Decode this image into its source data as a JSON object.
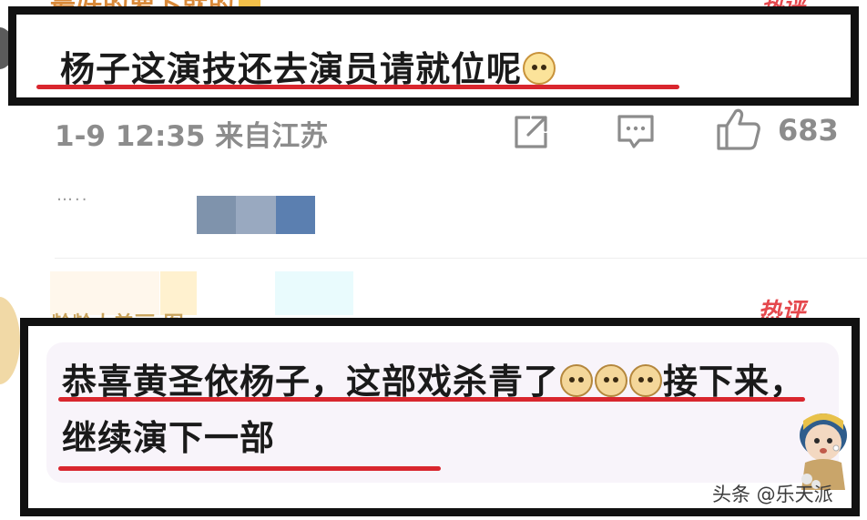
{
  "top_cutoff": {
    "text": "最好的萝卜就的",
    "hot_badge": "热评"
  },
  "comment_1": {
    "text": "杨子这演技还去演员请就位呢",
    "emoji": "shushing-face-emoji"
  },
  "meta": {
    "time_location": "1-9 12:35 来自江苏",
    "share_icon": "share-icon",
    "comment_icon": "comment-icon",
    "like_icon": "like-icon",
    "like_count": "683"
  },
  "blurred": {
    "ellipsis": "…..",
    "mosaic_colors": [
      "#7f93ac",
      "#99a9c0",
      "#5b7fb0"
    ]
  },
  "mid_cutoff": {
    "text": "龄龄大美丽 图",
    "hot_badge": "热评"
  },
  "comment_2": {
    "part_1": "恭喜黄圣依杨子，这部戏杀青了",
    "emojis": [
      "doge-emoji",
      "doge-emoji",
      "doge-emoji"
    ],
    "part_2": "接下来，继续演下一部"
  },
  "watermark": {
    "text": "头条 @乐天派"
  },
  "colors": {
    "highlight_border": "#111111",
    "underline_red": "#d9262e",
    "meta_gray": "#8c8c8c",
    "hot_red": "#e5484d"
  }
}
